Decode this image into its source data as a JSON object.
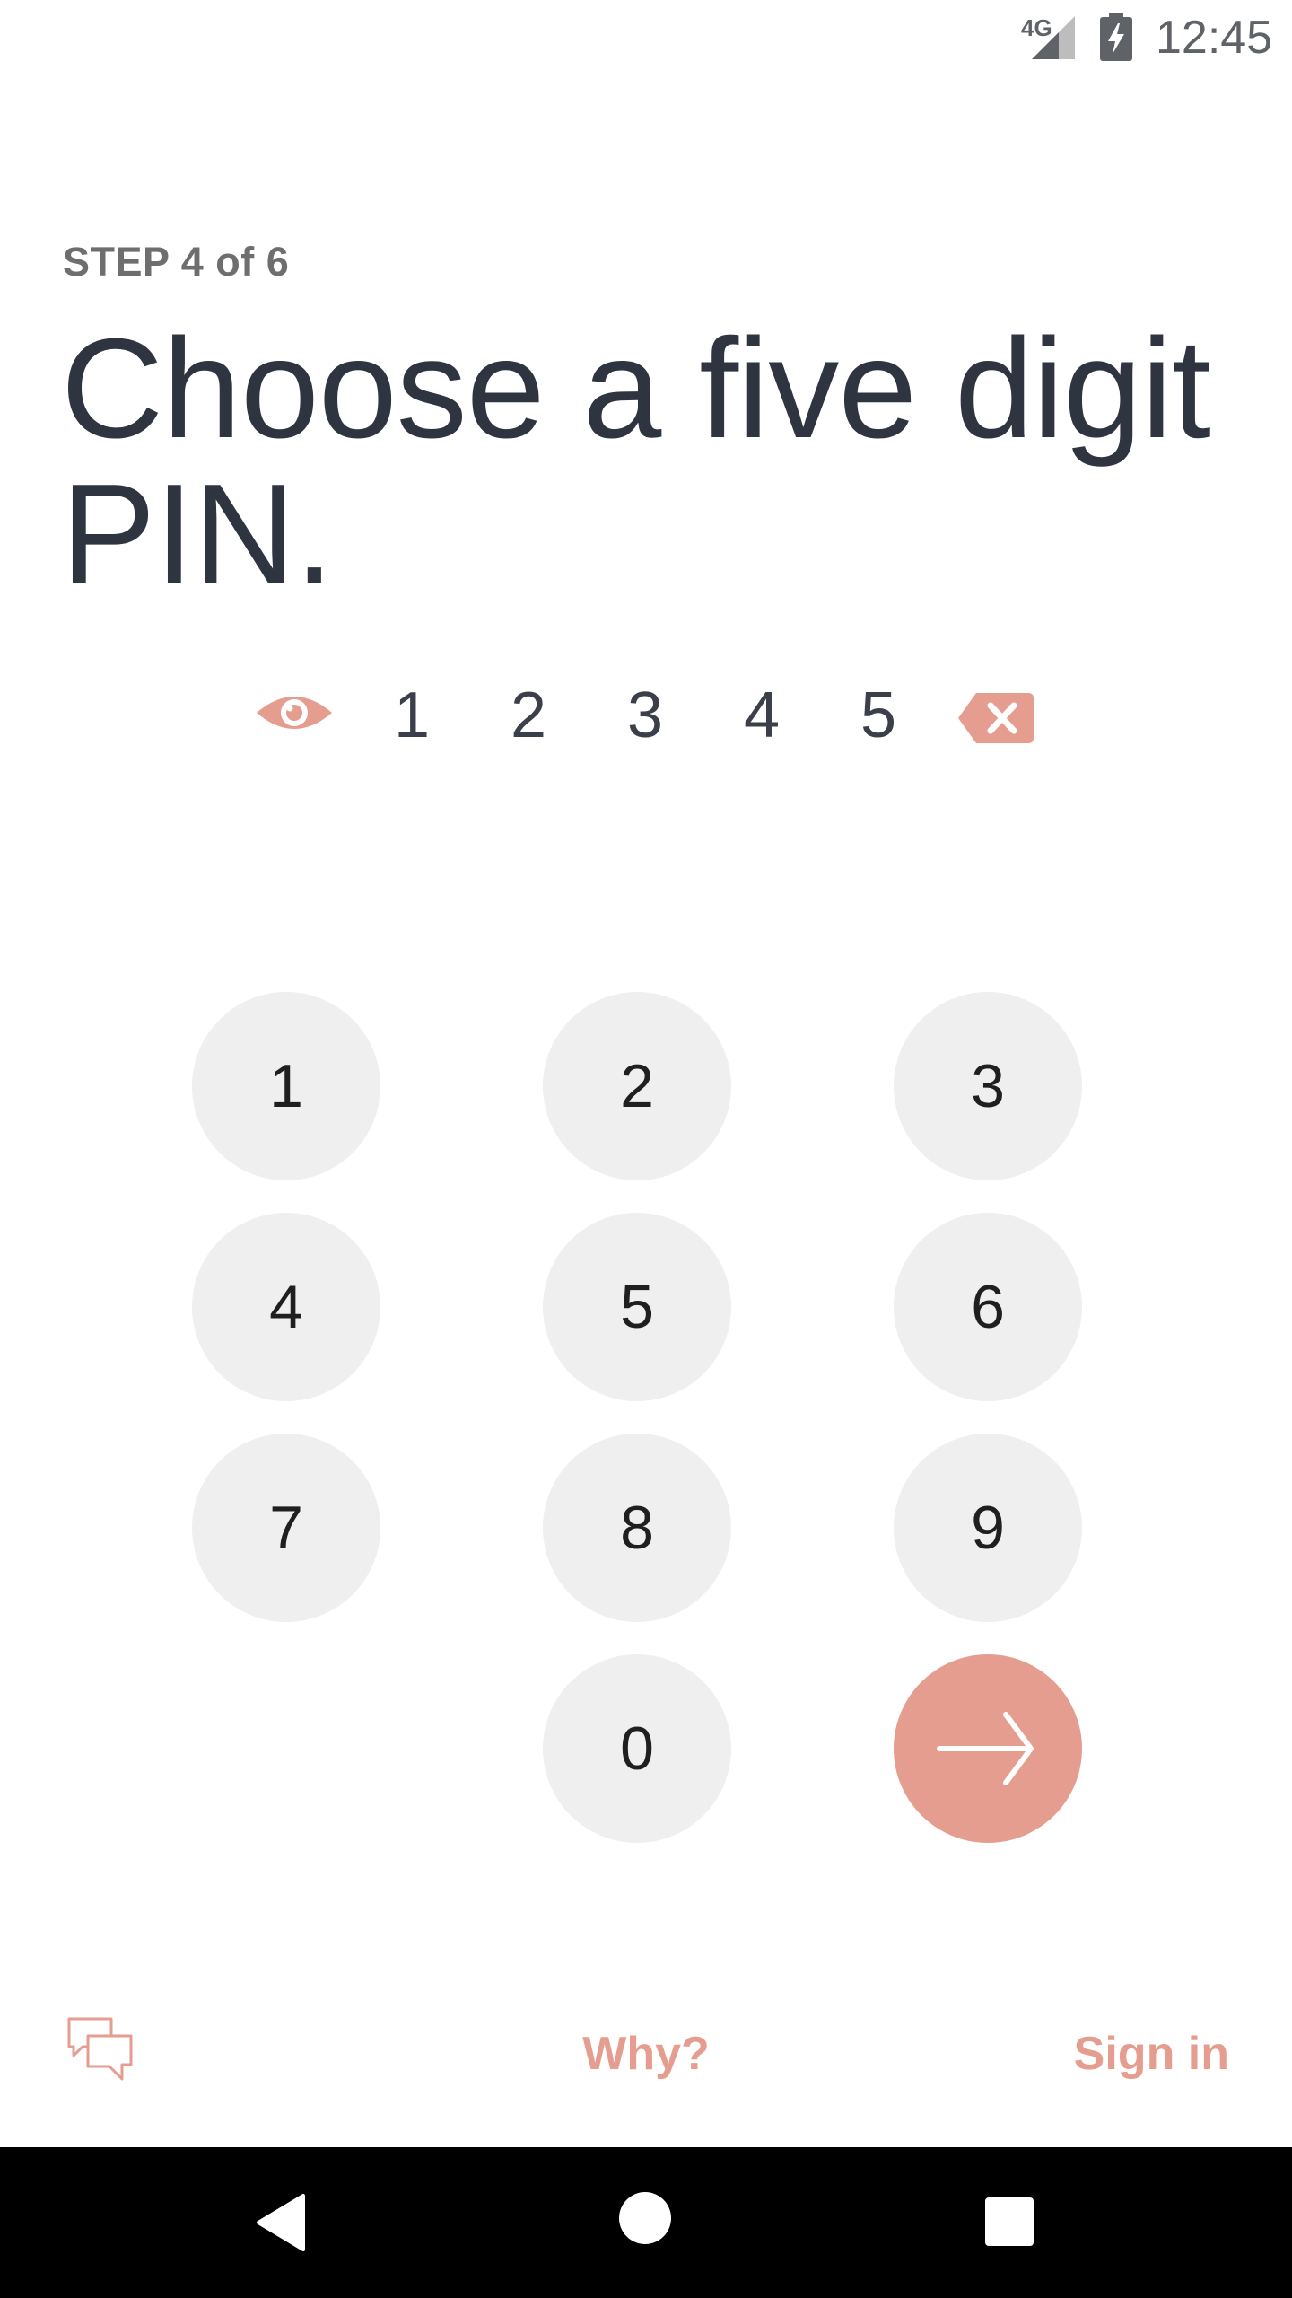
{
  "status_bar": {
    "network": "4G",
    "time": "12:45",
    "icons": [
      "signal-icon",
      "battery-charging-icon"
    ]
  },
  "step_label": "STEP 4 of 6",
  "title": "Choose a five digit PIN.",
  "pin": {
    "digits": [
      "1",
      "2",
      "3",
      "4",
      "5"
    ],
    "toggle_icon": "eye-icon",
    "delete_icon": "backspace-icon"
  },
  "keypad": {
    "keys": [
      "1",
      "2",
      "3",
      "4",
      "5",
      "6",
      "7",
      "8",
      "9",
      "0"
    ],
    "submit_icon": "arrow-right-icon"
  },
  "footer": {
    "chat_icon": "chat-icon",
    "why_label": "Why?",
    "signin_label": "Sign in"
  },
  "nav_bar": {
    "icons": [
      "back-icon",
      "home-icon",
      "recents-icon"
    ]
  },
  "colors": {
    "accent": "#e59d90",
    "key_background": "#efefef",
    "title_text": "#2f3441"
  }
}
